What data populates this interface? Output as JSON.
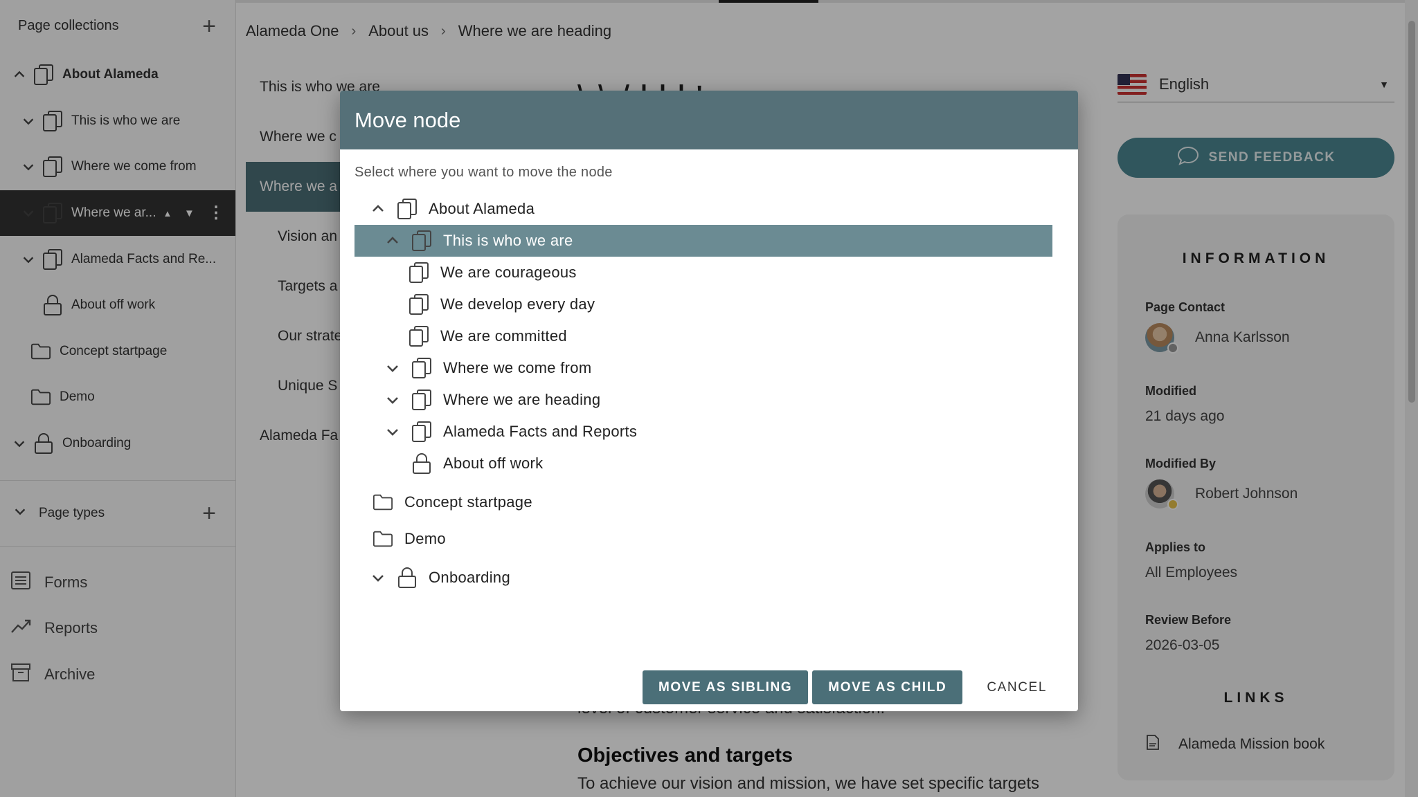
{
  "sidebar": {
    "collections_label": "Page collections",
    "items": [
      {
        "label": "About Alameda"
      },
      {
        "label": "This is who we are"
      },
      {
        "label": "Where we come from"
      },
      {
        "label": "Where we ar..."
      },
      {
        "label": "Alameda Facts and Re..."
      },
      {
        "label": "About off work"
      },
      {
        "label": "Concept startpage"
      },
      {
        "label": "Demo"
      },
      {
        "label": "Onboarding"
      }
    ],
    "page_types_label": "Page types",
    "nav": [
      {
        "label": "Forms"
      },
      {
        "label": "Reports"
      },
      {
        "label": "Archive"
      }
    ]
  },
  "breadcrumb": [
    "Alameda One",
    "About us",
    "Where we are heading"
  ],
  "toc": [
    {
      "label": "This is who we are"
    },
    {
      "label": "Where we c"
    },
    {
      "label": "Where we a"
    },
    {
      "label": "Vision an"
    },
    {
      "label": "Targets a"
    },
    {
      "label": "Our strate"
    },
    {
      "label": "Unique S"
    },
    {
      "label": "Alameda Fa"
    }
  ],
  "article": {
    "title_fragment": "\\ \\ / l                        l      l '",
    "para_end": "level of customer service and satisfaction.",
    "section_heading": "Objectives and targets",
    "section_text": "To achieve our vision and mission, we have set specific targets"
  },
  "language": {
    "selected": "English"
  },
  "feedback_label": "SEND FEEDBACK",
  "info": {
    "heading": "INFORMATION",
    "page_contact_label": "Page Contact",
    "page_contact": "Anna Karlsson",
    "modified_label": "Modified",
    "modified": "21 days ago",
    "modified_by_label": "Modified By",
    "modified_by": "Robert Johnson",
    "applies_to_label": "Applies to",
    "applies_to": "All Employees",
    "review_before_label": "Review Before",
    "review_before": "2026-03-05",
    "links_heading": "LINKS",
    "link": "Alameda Mission book"
  },
  "modal": {
    "title": "Move node",
    "subtitle": "Select where you want to move the node",
    "tree": [
      {
        "label": "About Alameda"
      },
      {
        "label": "This is who we are"
      },
      {
        "label": "We are courageous"
      },
      {
        "label": "We develop every day"
      },
      {
        "label": "We are committed"
      },
      {
        "label": "Where we come from"
      },
      {
        "label": "Where we are heading"
      },
      {
        "label": "Alameda Facts and Reports"
      },
      {
        "label": "About off work"
      },
      {
        "label": "Concept startpage"
      },
      {
        "label": "Demo"
      },
      {
        "label": "Onboarding"
      }
    ],
    "move_sibling_label": "MOVE AS SIBLING",
    "move_child_label": "MOVE AS CHILD",
    "cancel_label": "CANCEL"
  },
  "colors": {
    "accent": "#4b6f78",
    "modal_header": "#557078",
    "selected_tree_row": "#6b8b93",
    "feedback_button": "#4b8792"
  },
  "icons": [
    "page-icon",
    "lock-icon",
    "folder-icon",
    "chevron-down-icon",
    "chevron-up-icon",
    "plus-icon",
    "forms-icon",
    "reports-icon",
    "archive-icon",
    "chat-icon",
    "pdf-icon",
    "more-vert-icon"
  ]
}
